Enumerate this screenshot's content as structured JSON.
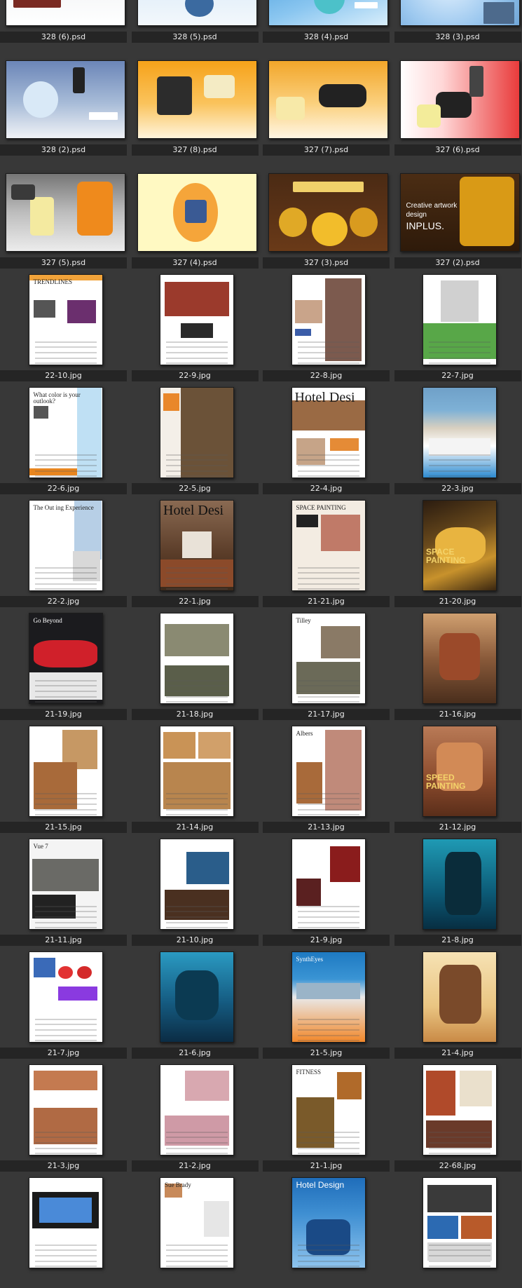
{
  "colors": {
    "background": "#383838",
    "label_bar": "#252525",
    "label_text": "#ececec"
  },
  "thumbnails": [
    {
      "name": "328 (6).psd",
      "kind": "land",
      "art": "ship"
    },
    {
      "name": "328 (5).psd",
      "kind": "land",
      "art": "robot-sky"
    },
    {
      "name": "328 (4).psd",
      "kind": "land",
      "art": "robot-blue"
    },
    {
      "name": "328 (3).psd",
      "kind": "land",
      "art": "robot-city"
    },
    {
      "name": "328 (2).psd",
      "kind": "land",
      "art": "globe-robot"
    },
    {
      "name": "327 (8).psd",
      "kind": "land",
      "art": "orange-robot"
    },
    {
      "name": "327 (7).psd",
      "kind": "land",
      "art": "orange-robot2"
    },
    {
      "name": "327 (6).psd",
      "kind": "land",
      "art": "red-robot"
    },
    {
      "name": "327 (5).psd",
      "kind": "land",
      "art": "gray-robot"
    },
    {
      "name": "327 (4).psd",
      "kind": "land",
      "art": "cream-circle"
    },
    {
      "name": "327 (3).psd",
      "kind": "land",
      "art": "gold-coins"
    },
    {
      "name": "327 (2).psd",
      "kind": "land",
      "art": "creative",
      "logo_lines": [
        "Creative artwork",
        "design",
        "INPLUS."
      ]
    },
    {
      "name": "22-10.jpg",
      "kind": "port",
      "art": "page-orange",
      "page_title": "TRENDLINES"
    },
    {
      "name": "22-9.jpg",
      "kind": "port",
      "art": "page-sofa"
    },
    {
      "name": "22-8.jpg",
      "kind": "port",
      "art": "page-photos"
    },
    {
      "name": "22-7.jpg",
      "kind": "port",
      "art": "page-green"
    },
    {
      "name": "22-6.jpg",
      "kind": "port",
      "art": "page-blue",
      "page_title": "What color is your outlook?"
    },
    {
      "name": "22-5.jpg",
      "kind": "port",
      "art": "page-brown"
    },
    {
      "name": "22-4.jpg",
      "kind": "port",
      "art": "page-hotel",
      "page_title": "Hotel Desi"
    },
    {
      "name": "22-3.jpg",
      "kind": "port",
      "art": "page-pool"
    },
    {
      "name": "22-2.jpg",
      "kind": "port",
      "art": "page-outing",
      "page_title": "The Out ing Experience"
    },
    {
      "name": "22-1.jpg",
      "kind": "port",
      "art": "page-hotel2",
      "page_title": "Hotel Desi"
    },
    {
      "name": "21-21.jpg",
      "kind": "port",
      "art": "page-sketch",
      "page_title": "SPACE PAINTING"
    },
    {
      "name": "21-20.jpg",
      "kind": "port",
      "art": "poster-space",
      "page_title": "SPACE PAINTING"
    },
    {
      "name": "21-19.jpg",
      "kind": "port",
      "art": "page-car",
      "page_title": "Go Beyond"
    },
    {
      "name": "21-18.jpg",
      "kind": "port",
      "art": "page-land"
    },
    {
      "name": "21-17.jpg",
      "kind": "port",
      "art": "page-land2",
      "page_title": "Tilley"
    },
    {
      "name": "21-16.jpg",
      "kind": "port",
      "art": "poster-rider"
    },
    {
      "name": "21-15.jpg",
      "kind": "port",
      "art": "page-desert"
    },
    {
      "name": "21-14.jpg",
      "kind": "port",
      "art": "page-desert2"
    },
    {
      "name": "21-13.jpg",
      "kind": "port",
      "art": "page-albers",
      "page_title": "Albers"
    },
    {
      "name": "21-12.jpg",
      "kind": "port",
      "art": "poster-speed",
      "page_title": "SPEED PAINTING"
    },
    {
      "name": "21-11.jpg",
      "kind": "port",
      "art": "page-vue",
      "page_title": "Vue 7"
    },
    {
      "name": "21-10.jpg",
      "kind": "port",
      "art": "page-sea"
    },
    {
      "name": "21-9.jpg",
      "kind": "port",
      "art": "page-red"
    },
    {
      "name": "21-8.jpg",
      "kind": "port",
      "art": "poster-teal"
    },
    {
      "name": "21-7.jpg",
      "kind": "port",
      "art": "page-colorwheel"
    },
    {
      "name": "21-6.jpg",
      "kind": "port",
      "art": "poster-octopus"
    },
    {
      "name": "21-5.jpg",
      "kind": "port",
      "art": "page-synth",
      "page_title": "SynthEyes"
    },
    {
      "name": "21-4.jpg",
      "kind": "port",
      "art": "poster-cartoon"
    },
    {
      "name": "21-3.jpg",
      "kind": "port",
      "art": "page-strip"
    },
    {
      "name": "21-2.jpg",
      "kind": "port",
      "art": "page-sketch2"
    },
    {
      "name": "21-1.jpg",
      "kind": "port",
      "art": "page-fitness",
      "page_title": "FITNESS"
    },
    {
      "name": "22-68.jpg",
      "kind": "port",
      "art": "page-kitchen"
    },
    {
      "name": "",
      "kind": "port",
      "art": "page-tv"
    },
    {
      "name": "",
      "kind": "port",
      "art": "page-sue",
      "page_title": "Sue Brady"
    },
    {
      "name": "",
      "kind": "port",
      "art": "page-hotelblue",
      "page_title": "Hotel Design"
    },
    {
      "name": "",
      "kind": "port",
      "art": "page-collage"
    }
  ]
}
